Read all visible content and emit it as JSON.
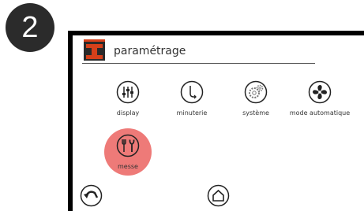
{
  "step": {
    "number": "2"
  },
  "header": {
    "title": "paramétrage",
    "logo_icon": "app-logo-icon"
  },
  "menu": [
    {
      "label": "display",
      "icon": "sliders-icon"
    },
    {
      "label": "minuterie",
      "icon": "clock-icon"
    },
    {
      "label": "système",
      "icon": "gear-icon"
    },
    {
      "label": "mode automatique",
      "icon": "fan-icon"
    },
    {
      "label": "messe",
      "icon": "tools-icon",
      "highlighted": true
    }
  ],
  "nav": {
    "back_icon": "back-arrow-icon",
    "home_icon": "home-icon"
  },
  "colors": {
    "highlight": "#ee7a78",
    "logo_red": "#d6401a",
    "device_frame": "#000000"
  }
}
